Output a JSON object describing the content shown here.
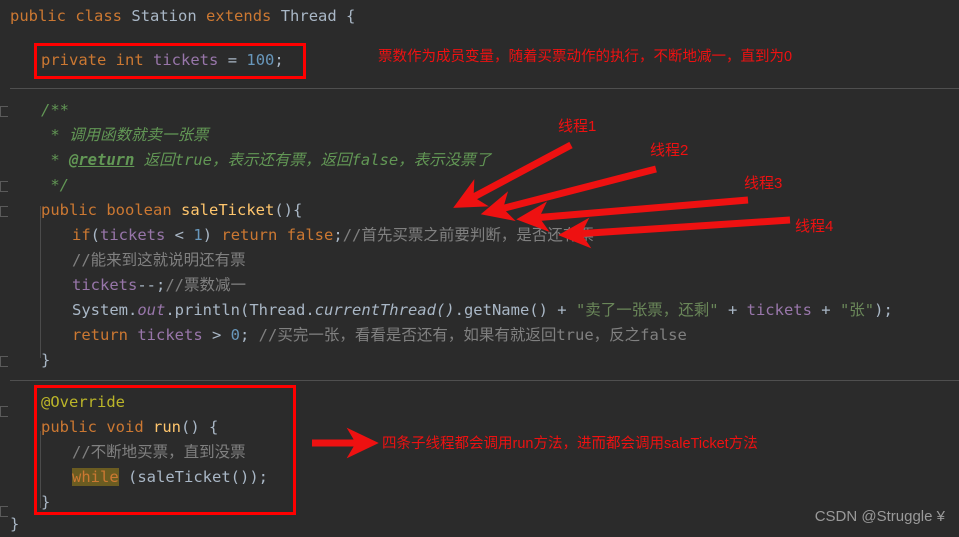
{
  "editor": {
    "background": "#2b2b2b",
    "default_text_color": "#a9b7c6",
    "font_size_px": 15.5,
    "line_height_px": 25
  },
  "code": {
    "line01": {
      "kw_public": "public",
      "kw_class": "class",
      "class_name": "Station",
      "kw_extends": "extends",
      "super_name": "Thread",
      "brace": "{"
    },
    "line02": {
      "kw_private": "private",
      "kw_int": "int",
      "field": "tickets",
      "eq": "=",
      "value": "100",
      "semi": ";"
    },
    "line03": {
      "doc": "/**"
    },
    "line04": {
      "doc": " * 调用函数就卖一张票"
    },
    "line05": {
      "star": " * ",
      "tag": "@return",
      "rest": " 返回true，表示还有票，返回false，表示没票了"
    },
    "line06": {
      "doc": " */"
    },
    "line07": {
      "kw_public": "public",
      "kw_boolean": "boolean",
      "method": "saleTicket",
      "tail": "(){"
    },
    "line08": {
      "kw_if": "if",
      "p1": "(",
      "field": "tickets",
      "lt": " < ",
      "one": "1",
      "p2": ") ",
      "kw_return": "return",
      "bool_false": " false",
      "semi": ";",
      "comment": "//首先买票之前要判断，是否还有票"
    },
    "line09": {
      "comment": "//能来到这就说明还有票"
    },
    "line10": {
      "field": "tickets",
      "dec": "--;",
      "comment": "//票数减一"
    },
    "line11": {
      "system": "System.",
      "out": "out",
      "dot": ".",
      "println": "println(",
      "thread": "Thread.",
      "currentThread": "currentThread()",
      "getName": ".getName() ",
      "plus1": "+ ",
      "str1": "\"卖了一张票，还剩\"",
      "plus2": " + ",
      "field": "tickets",
      "plus3": " + ",
      "str2": "\"张\"",
      "close": ");"
    },
    "line12": {
      "kw_return": "return",
      "field": " tickets",
      "gt": " > ",
      "zero": "0",
      "semi": "; ",
      "comment": "//买完一张，看看是否还有，如果有就返回true，反之false"
    },
    "line13": {
      "brace": "}"
    },
    "line14": {
      "annotation": "@Override"
    },
    "line15": {
      "kw_public": "public",
      "kw_void": "void",
      "method": "run",
      "tail": "() {"
    },
    "line16": {
      "comment": "//不断地买票，直到没票"
    },
    "line17": {
      "kw_while": "while",
      "call": " (saleTicket());"
    },
    "line18": {
      "brace": "}"
    },
    "line19": {
      "brace": "}"
    }
  },
  "annotations": {
    "accent_color": "#ff0000",
    "note_field": "票数作为成员变量，随着买票动作的执行，不断地减一，直到为0",
    "note_run": "四条子线程都会调用run方法，进而都会调用saleTicket方法",
    "thread_labels": [
      {
        "text": "线程1"
      },
      {
        "text": "线程2"
      },
      {
        "text": "线程3"
      },
      {
        "text": "线程4"
      }
    ]
  },
  "watermark": {
    "text": "CSDN @Struggle ¥"
  }
}
